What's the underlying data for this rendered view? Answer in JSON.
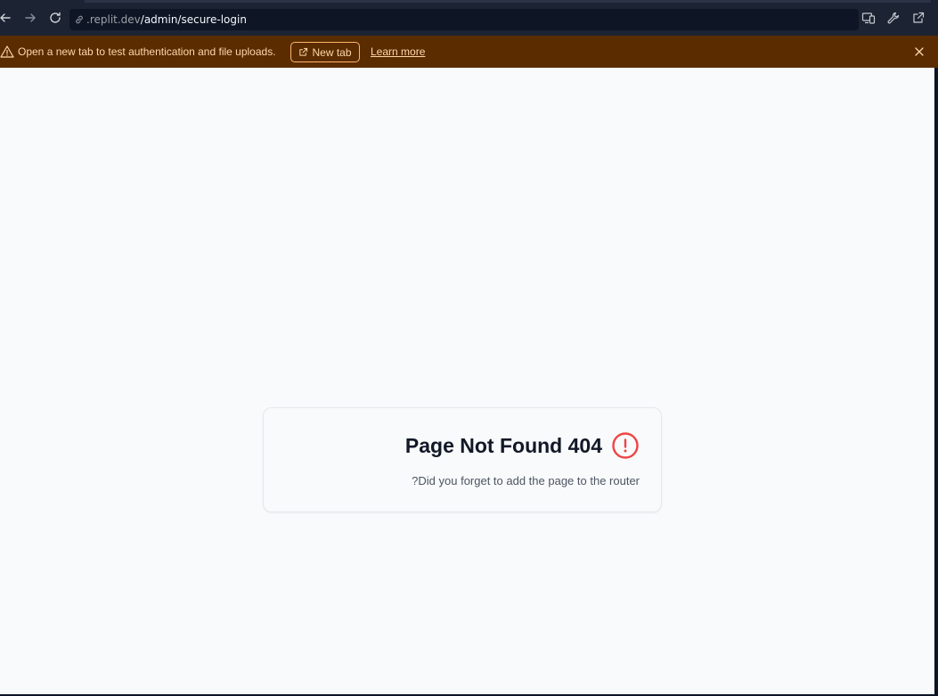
{
  "browser": {
    "url_host": ".replit.dev",
    "url_path": "/admin/secure-login",
    "icons": [
      "back-icon",
      "forward-icon",
      "reload-icon",
      "link-icon",
      "devices-icon",
      "wrench-icon",
      "external-link-icon"
    ]
  },
  "banner": {
    "message": "Open a new tab to test authentication and file uploads.",
    "new_tab_label": "New tab",
    "learn_more_label": "Learn more",
    "colors": {
      "background": "#5a2c00",
      "text": "#ffd8a8"
    }
  },
  "page": {
    "title": "Page Not Found 404",
    "description": "?Did you forget to add the page to the router",
    "colors": {
      "alert": "#ef4444",
      "background": "#f8fafc"
    }
  }
}
